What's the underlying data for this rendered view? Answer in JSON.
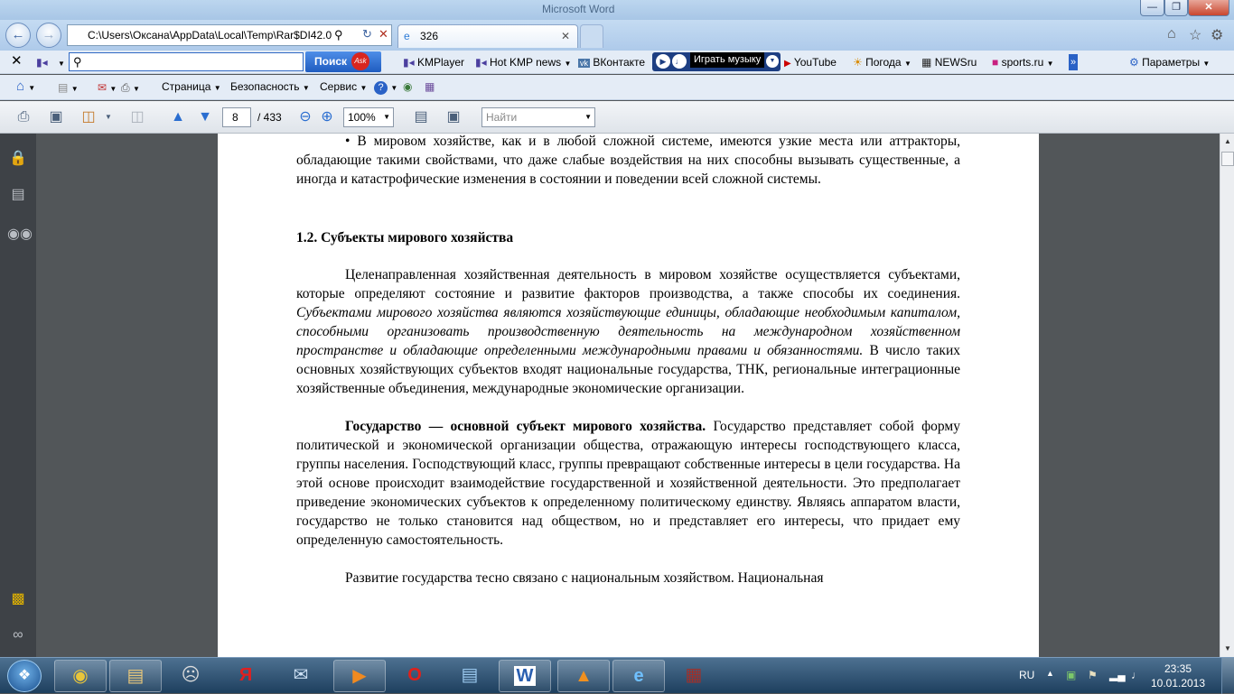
{
  "window": {
    "title": "Microsoft Word"
  },
  "browser": {
    "address": "C:\\Users\\Оксана\\AppData\\Local\\Temp\\Rar$DI42.0",
    "tab_title": "326"
  },
  "toolbar1": {
    "search_button": "Поиск",
    "ask_logo": "Ask",
    "items": [
      "KMPlayer",
      "Hot KMP news",
      "ВКонтакте",
      "YouTube",
      "Погода",
      "NEWSru",
      "sports.ru"
    ],
    "music_label": "Играть музыку",
    "params_label": "Параметры"
  },
  "toolbar2": {
    "menu": [
      "Страница",
      "Безопасность",
      "Сервис"
    ]
  },
  "pdf": {
    "current_page": "8",
    "total_pages": "/ 433",
    "zoom": "100%",
    "find_placeholder": "Найти"
  },
  "document": {
    "p1": "• В мировом хозяйстве, как и в любой сложной системе, имеются узкие места или аттракторы, обладающие такими свойствами, что даже слабые воздействия на них способны вызывать существенные, а иногда и катастрофические изменения в состоянии и поведении всей сложной системы.",
    "heading": "1.2. Субъекты мирового хозяйства",
    "p2_a": "Целенаправленная хозяйственная деятельность в мировом хозяйстве осуществляется субъектами, которые определяют состояние и развитие факторов производства, а также способы их соединения.",
    "p2_b": "Субъектами мирового хозяйства являются хозяйствующие единицы, обладающие необходимым капиталом, способными организовать производственную деятельность на международном хозяйственном пространстве и обладающие определенными международными правами и обязанностями.",
    "p2_c": "В число таких основных хозяйствующих субъектов входят национальные государства, ТНК, региональные интеграционные хозяйственные объединения, международные экономические организации.",
    "p3_bold": "Государство — основной субъект мирового хозяйства.",
    "p3_rest": "Государство представляет собой форму политической и экономической организации общества, отражающую интересы господствующего класса, группы населения. Господствующий класс, группы превращают собственные интересы в цели государства. На этой основе происходит взаимодействие государственной и хозяйственной деятельности. Это предполагает приведение экономических субъектов к определенному политическому единству. Являясь аппаратом власти, государство не только становится над обществом, но и представляет его интересы, что придает ему определенную самостоятельность.",
    "p4": "Развитие государства тесно связано с национальным хозяйством. Национальная"
  },
  "taskbar": {
    "apps": [
      "chrome-icon",
      "explorer-folder-icon",
      "kmplayer-icon",
      "yandex-icon",
      "mail-icon",
      "media-player-icon",
      "opera-icon",
      "picture-viewer-icon",
      "word-icon",
      "network-icon",
      "ie-icon",
      "winrar-icon"
    ],
    "lang": "RU",
    "time": "23:35",
    "date": "10.01.2013"
  }
}
